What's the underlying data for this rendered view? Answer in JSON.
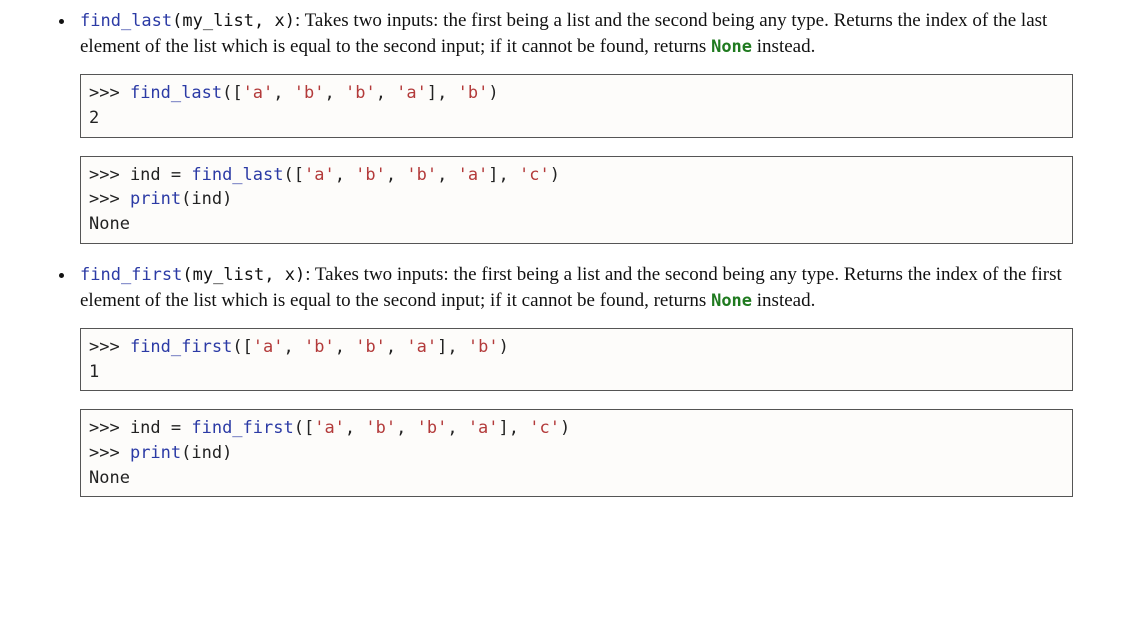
{
  "items": [
    {
      "sig_fn": "find_last",
      "sig_args": "(my_list, x)",
      "desc_a": ": Takes two inputs: the first being a list and the second being any type. Returns the index of the last element of the list which is equal to the second input; if it cannot be found, returns ",
      "kw_none": "None",
      "desc_b": " instead.",
      "ex1": {
        "p1": ">>> ",
        "fn": "find_last",
        "p2": "([",
        "s1": "'a'",
        "c1": ", ",
        "s2": "'b'",
        "c2": ", ",
        "s3": "'b'",
        "c3": ", ",
        "s4": "'a'",
        "p3": "], ",
        "s5": "'b'",
        "p4": ")",
        "out": "2"
      },
      "ex2": {
        "p1": ">>> ind = ",
        "fn": "find_last",
        "p2": "([",
        "s1": "'a'",
        "c1": ", ",
        "s2": "'b'",
        "c2": ", ",
        "s3": "'b'",
        "c3": ", ",
        "s4": "'a'",
        "p3": "], ",
        "s5": "'c'",
        "p4": ")",
        "l2a": ">>> ",
        "l2fn": "print",
        "l2b": "(ind)",
        "out": "None"
      }
    },
    {
      "sig_fn": "find_first",
      "sig_args": "(my_list, x)",
      "desc_a": ": Takes two inputs: the first being a list and the second being any type. Returns the index of the first element of the list which is equal to the second input; if it cannot be found, returns ",
      "kw_none": "None",
      "desc_b": " instead.",
      "ex1": {
        "p1": ">>> ",
        "fn": "find_first",
        "p2": "([",
        "s1": "'a'",
        "c1": ", ",
        "s2": "'b'",
        "c2": ", ",
        "s3": "'b'",
        "c3": ", ",
        "s4": "'a'",
        "p3": "], ",
        "s5": "'b'",
        "p4": ")",
        "out": "1"
      },
      "ex2": {
        "p1": ">>> ind = ",
        "fn": "find_first",
        "p2": "([",
        "s1": "'a'",
        "c1": ", ",
        "s2": "'b'",
        "c2": ", ",
        "s3": "'b'",
        "c3": ", ",
        "s4": "'a'",
        "p3": "], ",
        "s5": "'c'",
        "p4": ")",
        "l2a": ">>> ",
        "l2fn": "print",
        "l2b": "(ind)",
        "out": "None"
      }
    }
  ]
}
